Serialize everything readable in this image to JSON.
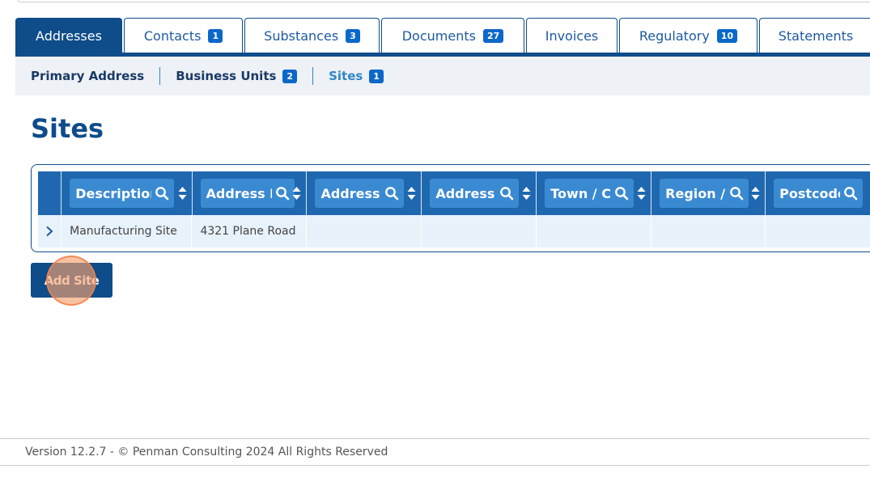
{
  "tabs": [
    {
      "label": "Addresses",
      "badge": ""
    },
    {
      "label": "Contacts",
      "badge": "1"
    },
    {
      "label": "Substances",
      "badge": "3"
    },
    {
      "label": "Documents",
      "badge": "27"
    },
    {
      "label": "Invoices",
      "badge": ""
    },
    {
      "label": "Regulatory",
      "badge": "10"
    },
    {
      "label": "Statements",
      "badge": ""
    }
  ],
  "subnav": [
    {
      "label": "Primary Address",
      "badge": ""
    },
    {
      "label": "Business Units",
      "badge": "2"
    },
    {
      "label": "Sites",
      "badge": "1"
    }
  ],
  "page": {
    "title": "Sites"
  },
  "grid": {
    "columns": [
      "Description",
      "Address L",
      "Address L",
      "Address L",
      "Town / Ci",
      "Region / S",
      "Postcode"
    ],
    "rows": [
      [
        "Manufacturing Site",
        "4321 Plane Road",
        "",
        "",
        "",
        "",
        ""
      ]
    ]
  },
  "actions": {
    "add_label": "Add Site"
  },
  "footer": {
    "text": "Version 12.2.7 - © Penman Consulting 2024 All Rights Reserved"
  },
  "colors": {
    "primary": "#0e4c8a",
    "header": "#1f68b0",
    "badge": "#0a68c9",
    "active_subnav": "#2f86c8"
  }
}
